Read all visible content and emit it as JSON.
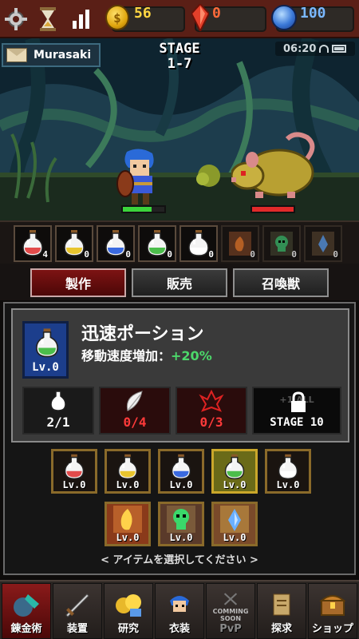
{
  "topbar": {
    "gold": "56",
    "ruby": "0",
    "gem": "100",
    "coin_symbol": "$"
  },
  "scene": {
    "player_name": "Murasaki",
    "stage_title": "STAGE",
    "stage_number": "1-7",
    "time": "06:20",
    "player_hp": 0.7,
    "enemy_hp": 1.0
  },
  "inventory": {
    "potions": [
      {
        "color": "#e24b4b",
        "count": "4"
      },
      {
        "color": "#e8c52e",
        "count": "0"
      },
      {
        "color": "#3a6ae0",
        "count": "0"
      },
      {
        "color": "#4bbd4b",
        "count": "0"
      },
      {
        "color": "#ffffff",
        "count": "0"
      }
    ],
    "scrolls": [
      {
        "icon": "fire-scroll-icon",
        "count": "0"
      },
      {
        "icon": "skull-scroll-icon",
        "count": "0"
      },
      {
        "icon": "ice-scroll-icon",
        "count": "0"
      }
    ]
  },
  "tabs": {
    "craft": "製作",
    "sell": "販売",
    "summon": "召喚獣"
  },
  "item": {
    "name": "迅速ポーション",
    "effect_label": "移動速度増加：",
    "effect_value": "+20%",
    "level": "Lv.0"
  },
  "materials": {
    "potion_count": "2/1",
    "feather_count": "0/4",
    "crystal_count": "0/3",
    "lock_text": "+1 ALL",
    "lock_stage": "STAGE 10"
  },
  "recipes": [
    {
      "type": "potion",
      "color": "#e24b4b",
      "level": "Lv.0",
      "selected": false
    },
    {
      "type": "potion",
      "color": "#e8c52e",
      "level": "Lv.0",
      "selected": false
    },
    {
      "type": "potion",
      "color": "#3a6ae0",
      "level": "Lv.0",
      "selected": false
    },
    {
      "type": "potion",
      "color": "#4bbd4b",
      "level": "Lv.0",
      "selected": true
    },
    {
      "type": "potion",
      "color": "#ffffff",
      "level": "Lv.0",
      "selected": false
    },
    {
      "type": "scroll",
      "icon": "fire-scroll-icon",
      "level": "Lv.0",
      "selected": false
    },
    {
      "type": "scroll",
      "icon": "skull-scroll-icon",
      "level": "Lv.0",
      "selected": false
    },
    {
      "type": "scroll",
      "icon": "ice-scroll-icon",
      "level": "Lv.0",
      "selected": false
    }
  ],
  "hint": "< アイテムを選択してください >",
  "nav": [
    {
      "label": "錬金術",
      "icon": "alchemy-icon",
      "active": true
    },
    {
      "label": "装置",
      "icon": "equipment-icon",
      "active": false
    },
    {
      "label": "研究",
      "icon": "research-icon",
      "active": false
    },
    {
      "label": "衣装",
      "icon": "costume-icon",
      "active": false
    },
    {
      "label": "PvP",
      "icon": "pvp-icon",
      "active": false,
      "soon": "COMMING SOON"
    },
    {
      "label": "探求",
      "icon": "quest-icon",
      "active": false
    },
    {
      "label": "ショップ",
      "icon": "shop-icon",
      "active": false
    }
  ]
}
